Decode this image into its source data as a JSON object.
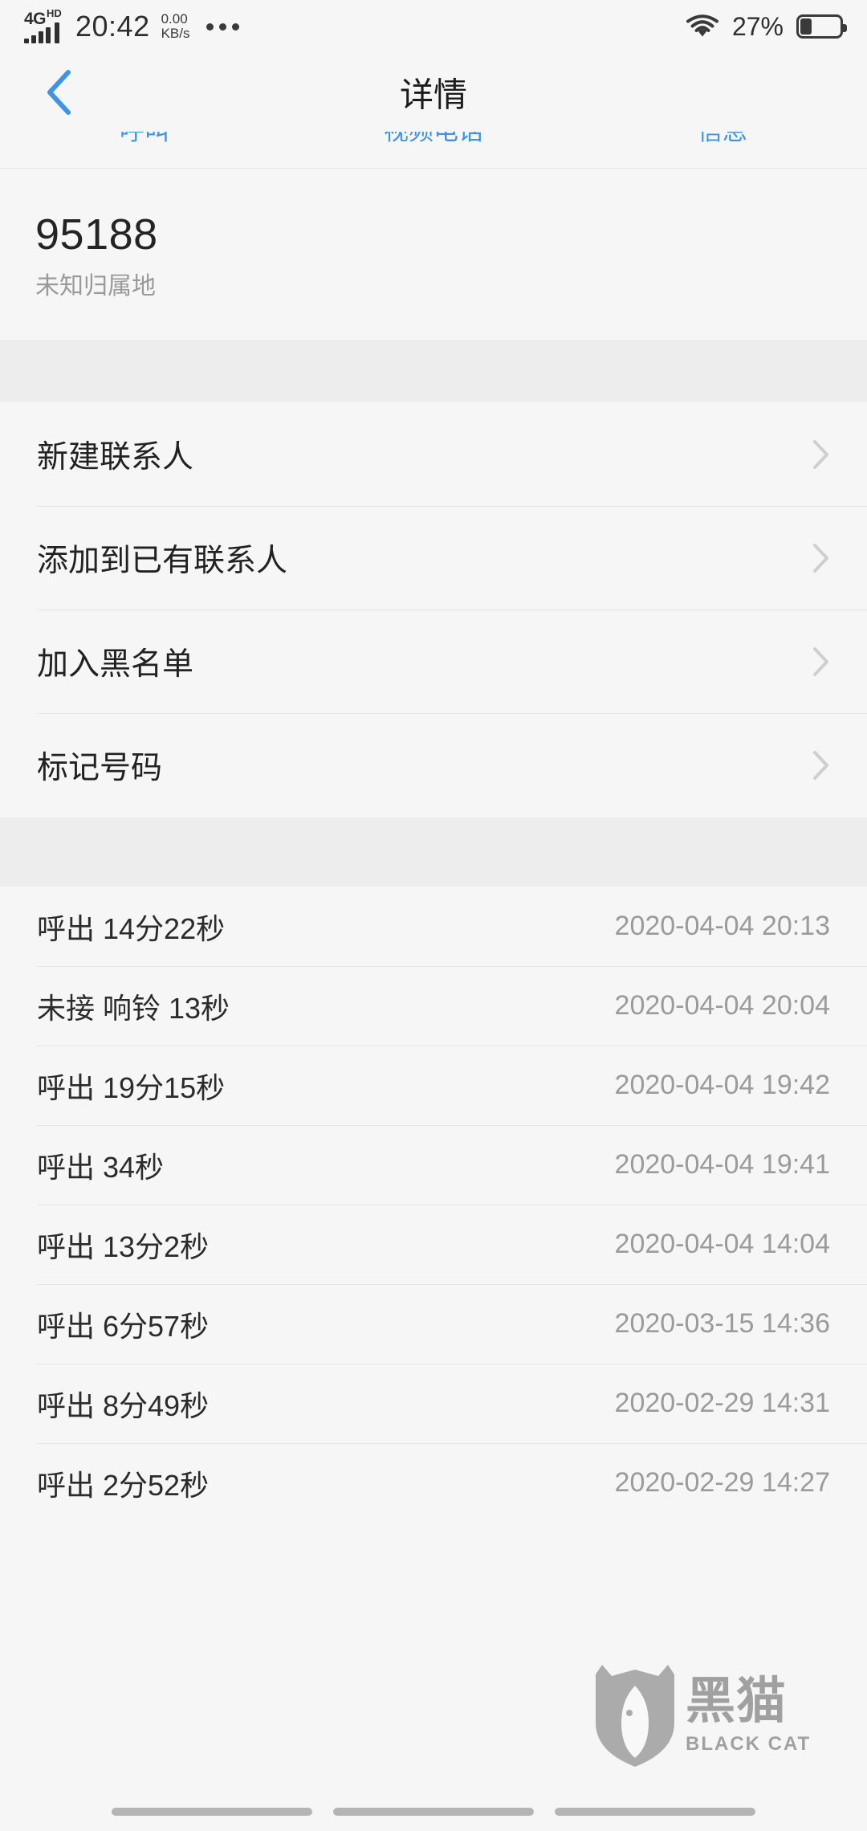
{
  "status_bar": {
    "network_type": "4G",
    "network_hd": "HD",
    "time": "20:42",
    "data_rate_value": "0.00",
    "data_rate_unit": "KB/s",
    "overflow": "•••",
    "battery_percent": "27%",
    "battery_level": 27,
    "wifi_icon": "wifi-icon",
    "signal_icon": "signal-bars-icon"
  },
  "header": {
    "back_icon": "chevron-left-icon",
    "title": "详情",
    "accent_color": "#3f94e8"
  },
  "action_tabs": [
    {
      "label": "呼叫"
    },
    {
      "label": "视频电话"
    },
    {
      "label": "信息"
    }
  ],
  "contact": {
    "number": "95188",
    "location": "未知归属地"
  },
  "actions": [
    {
      "label": "新建联系人",
      "chevron": "chevron-right-icon"
    },
    {
      "label": "添加到已有联系人",
      "chevron": "chevron-right-icon"
    },
    {
      "label": "加入黑名单",
      "chevron": "chevron-right-icon"
    },
    {
      "label": "标记号码",
      "chevron": "chevron-right-icon"
    }
  ],
  "call_log": [
    {
      "desc": "呼出 14分22秒",
      "when": "2020-04-04 20:13"
    },
    {
      "desc": "未接 响铃 13秒",
      "when": "2020-04-04 20:04"
    },
    {
      "desc": "呼出 19分15秒",
      "when": "2020-04-04 19:42"
    },
    {
      "desc": "呼出 34秒",
      "when": "2020-04-04 19:41"
    },
    {
      "desc": "呼出 13分2秒",
      "when": "2020-04-04 14:04"
    },
    {
      "desc": "呼出 6分57秒",
      "when": "2020-03-15 14:36"
    },
    {
      "desc": "呼出 8分49秒",
      "when": "2020-02-29 14:31"
    },
    {
      "desc": "呼出 2分52秒",
      "when": "2020-02-29 14:27"
    }
  ],
  "watermark": {
    "cn": "黑猫",
    "en": "BLACK CAT",
    "icon": "shield-cat-icon"
  },
  "navbar": {
    "pill_count": 3
  }
}
